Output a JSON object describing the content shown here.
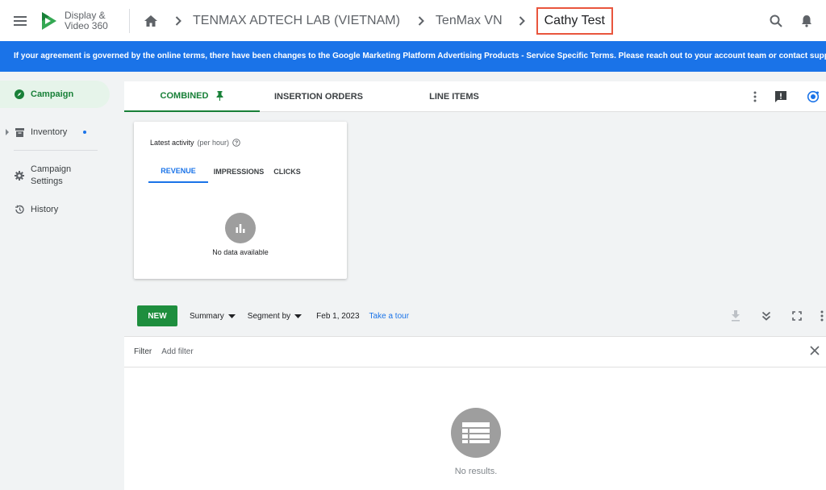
{
  "app": {
    "name_line1": "Display &",
    "name_line2": "Video 360"
  },
  "breadcrumb": [
    {
      "label": "TENMAX ADTECH LAB (VIETNAM)"
    },
    {
      "label": "TenMax VN"
    },
    {
      "label": "Cathy Test"
    }
  ],
  "banner": {
    "text": "If your agreement is governed by the online terms, there have been changes to the Google Marketing Platform Advertising Products - Service Specific Terms. Please reach out to your account team or contact support w"
  },
  "sidebar": {
    "items": [
      {
        "label": "Campaign"
      },
      {
        "label": "Inventory"
      },
      {
        "label": "Campaign Settings"
      },
      {
        "label": "History"
      }
    ]
  },
  "tabs": [
    {
      "label": "COMBINED"
    },
    {
      "label": "INSERTION ORDERS"
    },
    {
      "label": "LINE ITEMS"
    }
  ],
  "activity_card": {
    "title": "Latest activity",
    "subtitle": "(per hour)",
    "tabs": [
      {
        "label": "REVENUE"
      },
      {
        "label": "IMPRESSIONS"
      },
      {
        "label": "CLICKS"
      }
    ],
    "empty_text": "No data available"
  },
  "toolbar": {
    "new_label": "NEW",
    "summary_label": "Summary",
    "segment_label": "Segment by",
    "date": "Feb 1, 2023",
    "tour_label": "Take a tour"
  },
  "filter": {
    "label": "Filter",
    "placeholder": "Add filter"
  },
  "results": {
    "empty_text": "No results."
  },
  "colors": {
    "accent_green": "#188038",
    "banner_blue": "#1a73e8",
    "highlight_red": "#e9553d"
  }
}
